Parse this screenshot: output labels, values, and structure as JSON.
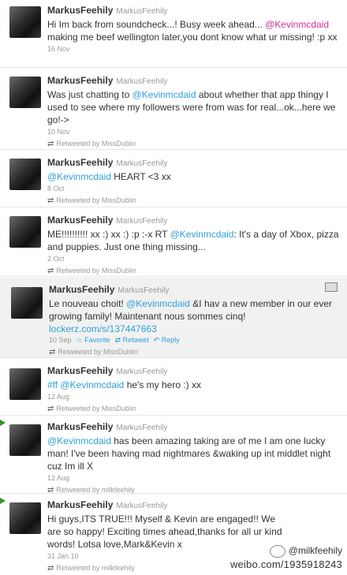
{
  "tweets": [
    {
      "name": "MarkusFeehily",
      "handle": "MarkusFeehily",
      "pre": "Hi Im back from soundcheck...! Busy week ahead... ",
      "mention": "@Kevinmcdaid",
      "post": " making me beef wellington later,you dont know what ur missing! :p xx",
      "date": "16 Nov",
      "rt": ""
    },
    {
      "name": "MarkusFeehily",
      "handle": "MarkusFeehily",
      "pre": "Was just chatting to ",
      "mention": "@Kevinmcdaid",
      "post": " about whether that app thingy I used to see where my followers were from was for real...ok...here we go!->",
      "date": "10 Nov",
      "rt": "Retweeted by MissDublin"
    },
    {
      "name": "MarkusFeehily",
      "handle": "MarkusFeehily",
      "pre": "",
      "mention": "@Kevinmcdaid",
      "post": " HEART <3 xx",
      "date": "8 Oct",
      "rt": "Retweeted by MissDublin"
    },
    {
      "name": "MarkusFeehily",
      "handle": "MarkusFeehily",
      "pre": "ME!!!!!!!!!! xx :) xx :) :p :-x RT ",
      "mention": "@Kevinmcdaid",
      "post": ": It's a day of Xbox, pizza and puppies. Just one thing missing...",
      "date": "2 Oct",
      "rt": "Retweeted by MissDublin"
    },
    {
      "name": "MarkusFeehily",
      "handle": "MarkusFeehily",
      "pre": "Le nouveau choit! ",
      "mention": "@Kevinmcdaid",
      "post": " &I hav a new member in our ever growing family! Maintenant nous sommes cinq!",
      "link": "lockerz.com/s/137447663",
      "date": "10 Sep",
      "fav": "Favorite",
      "retweet": "Retweet",
      "reply": "Reply",
      "rt": "Retweeted by MissDublin"
    },
    {
      "name": "MarkusFeehily",
      "handle": "MarkusFeehily",
      "hashtag": "#ff",
      "mention": "@Kevinmcdaid",
      "post": " he's my hero :) xx",
      "date": "12 Aug",
      "rt": "Retweeted by MissDublin"
    },
    {
      "name": "MarkusFeehily",
      "handle": "MarkusFeehily",
      "pre": "",
      "mention": "@Kevinmcdaid",
      "post": " has been amazing taking are of me I am one lucky man! I've been having mad nightmares &waking up int middlet night cuz Im ill X",
      "date": "12 Aug",
      "rt": "Retweeted by milkfeehily"
    },
    {
      "name": "MarkusFeehily",
      "handle": "MarkusFeehily",
      "pre": "Hi guys,ITS TRUE!!! Myself & Kevin are engaged!! We are so happy! Exciting times ahead,thanks for all ur kind words! Lotsa love,Mark&Kevin x",
      "mention": "",
      "post": "",
      "date": "31 Jan 10",
      "rt": "Retweeted by milkfeehily"
    }
  ],
  "watermark": {
    "user": "@milkfeehily",
    "url": "weibo.com/1935918243"
  }
}
